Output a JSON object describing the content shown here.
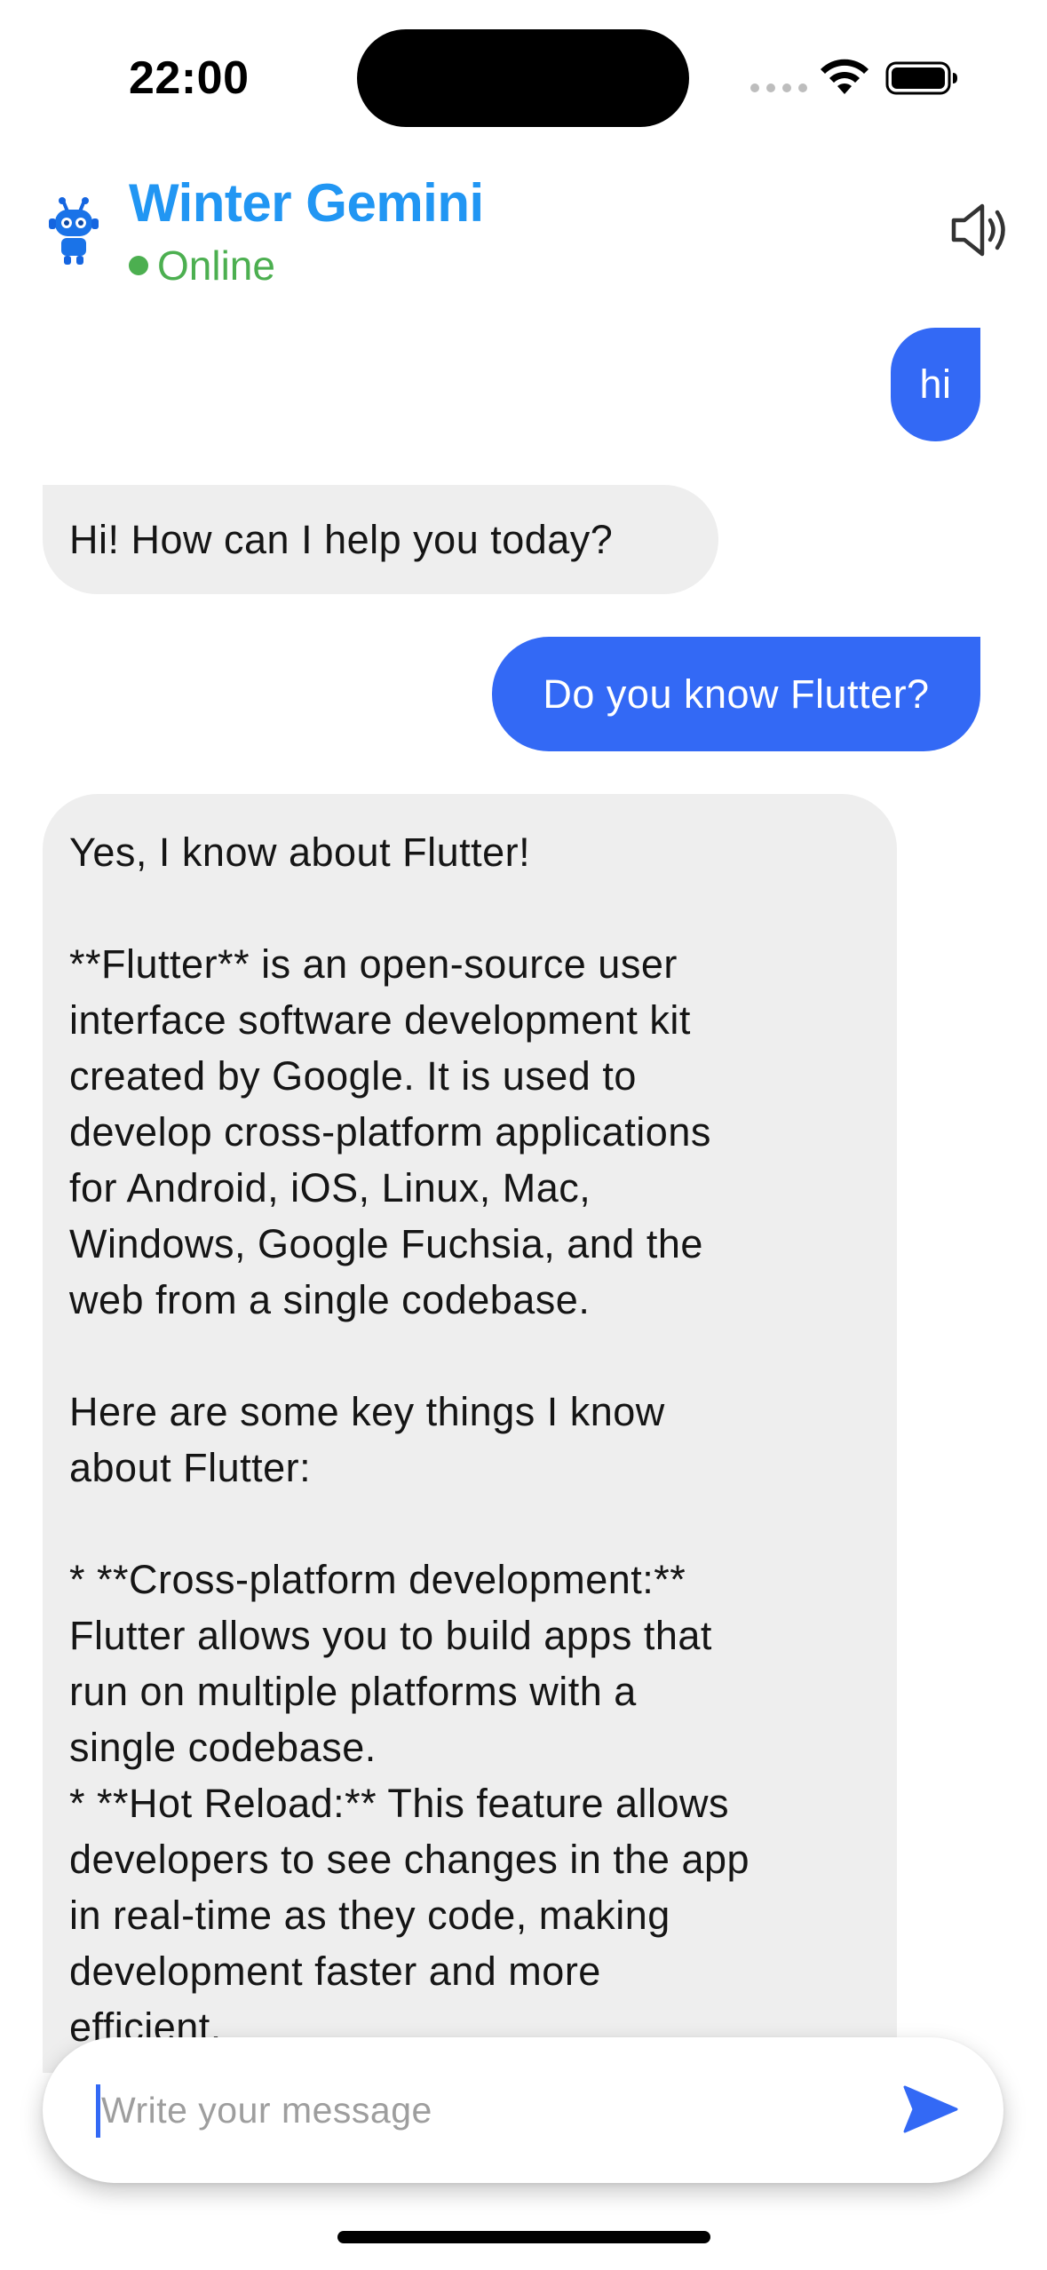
{
  "status_bar": {
    "time": "22:00",
    "icons": [
      "signal-dots-icon",
      "wifi-icon",
      "battery-icon"
    ]
  },
  "header": {
    "avatar_icon": "robot-icon",
    "title": "Winter Gemini",
    "status": "Online",
    "speaker_icon": "speaker-icon"
  },
  "messages": [
    {
      "role": "user",
      "text": "hi"
    },
    {
      "role": "bot",
      "text": "Hi! How can I help you today?"
    },
    {
      "role": "user",
      "text": "Do you know Flutter?"
    },
    {
      "role": "bot",
      "paragraphs": [
        "Yes, I know about Flutter!",
        "**Flutter** is an open-source user\ninterface software development kit\ncreated by Google. It is used to\ndevelop cross-platform applications\nfor Android, iOS, Linux, Mac,\nWindows, Google Fuchsia, and the\nweb from a single codebase.",
        "Here are some key things I know\nabout Flutter:",
        "* **Cross-platform development:**\nFlutter allows you to build apps that\nrun on multiple platforms with a\nsingle codebase.\n* **Hot Reload:** This feature allows\ndevelopers to see changes in the app\nin real-time as they code, making\ndevelopment faster and more\nefficient."
      ]
    }
  ],
  "composer": {
    "placeholder": "Write your message",
    "value": "",
    "send_icon": "send-icon"
  },
  "colors": {
    "accent": "#2196f3",
    "user_bubble": "#3369f5",
    "bot_bubble": "#eeeeee",
    "online": "#4caf50"
  }
}
